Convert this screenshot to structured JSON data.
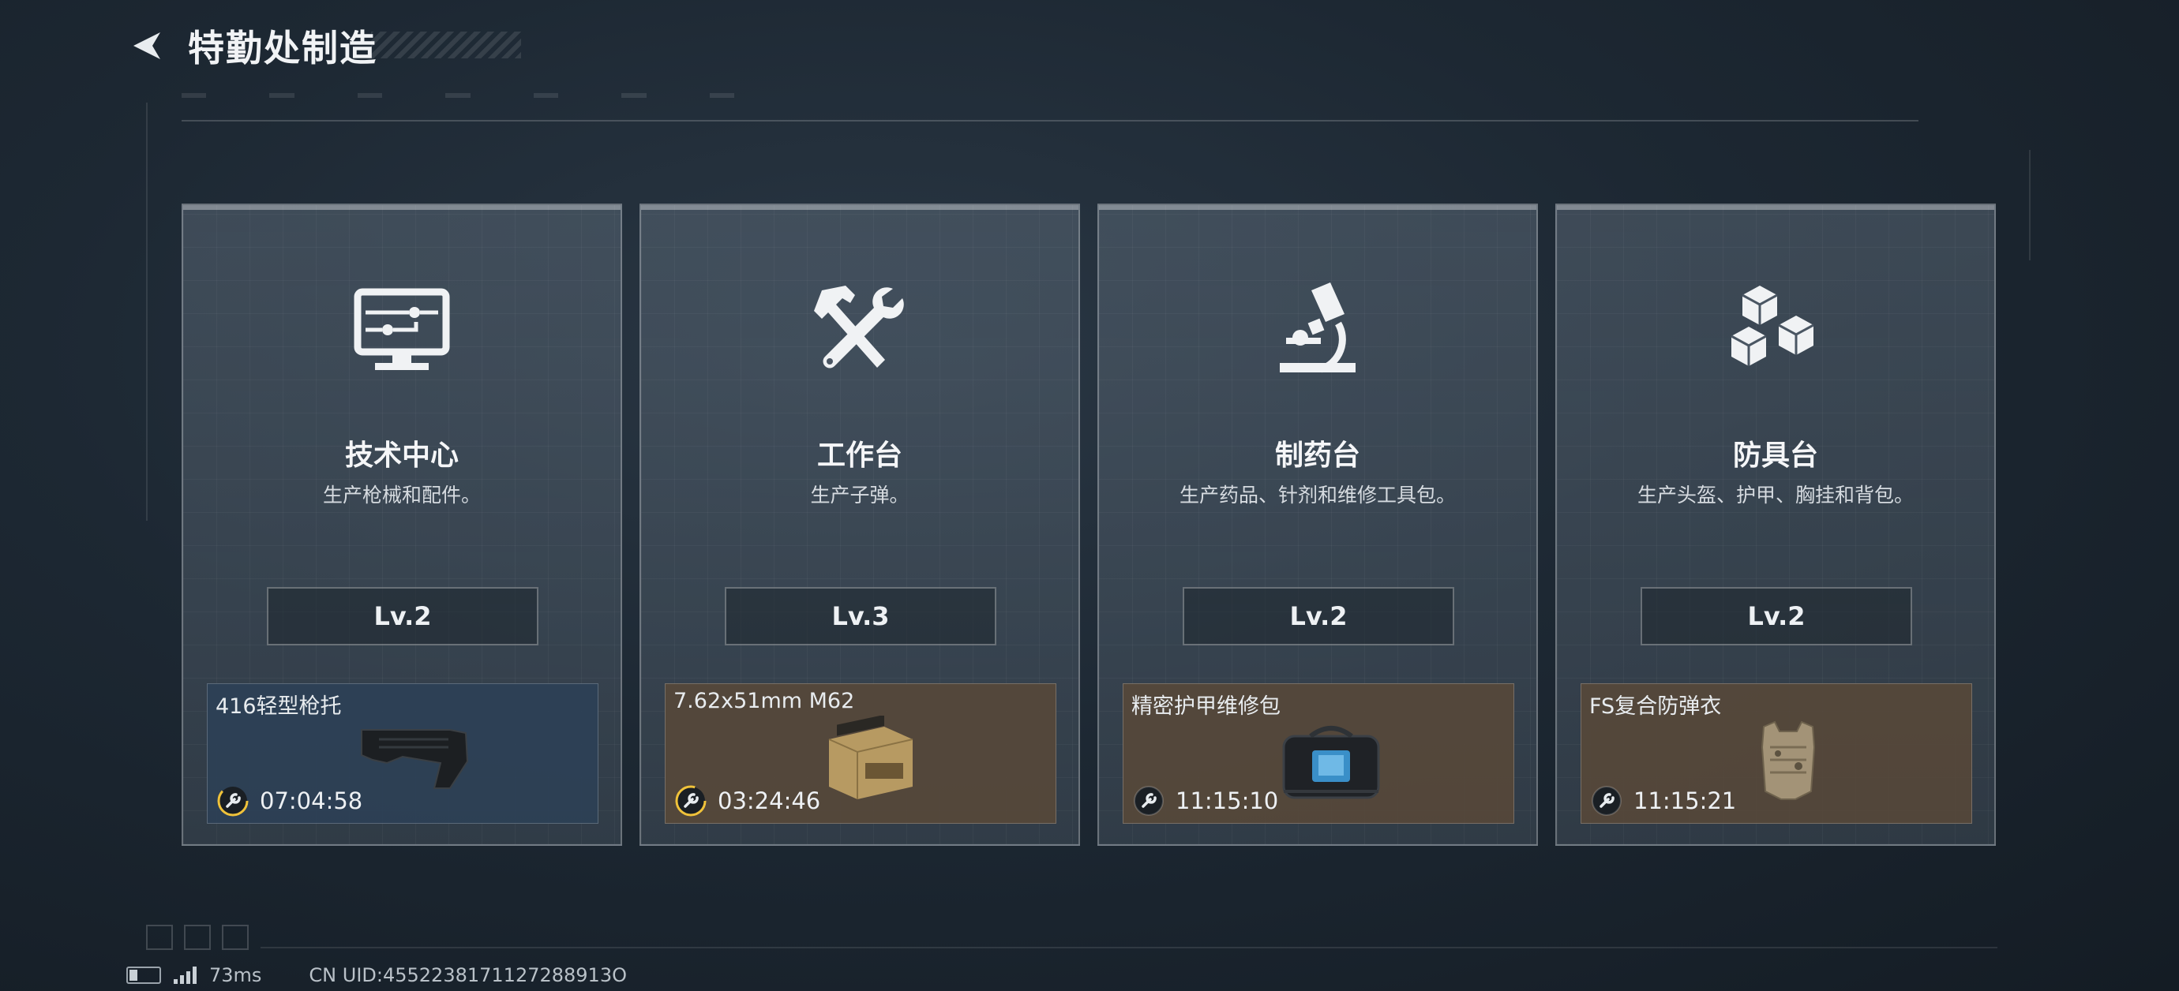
{
  "header": {
    "title": "特勤处制造"
  },
  "cards": [
    {
      "name": "技术中心",
      "desc": "生产枪械和配件。",
      "level": "Lv.2",
      "icon": "monitor-icon",
      "product": {
        "name": "416轻型枪托",
        "timer": "07:04:58",
        "style": "blue",
        "image": "rifle-stock"
      }
    },
    {
      "name": "工作台",
      "desc": "生产子弹。",
      "level": "Lv.3",
      "icon": "hammer-wrench-icon",
      "product": {
        "name": "7.62x51mm M62",
        "timer": "03:24:46",
        "style": "brown",
        "image": "ammo-box"
      }
    },
    {
      "name": "制药台",
      "desc": "生产药品、针剂和维修工具包。",
      "level": "Lv.2",
      "icon": "microscope-icon",
      "product": {
        "name": "精密护甲维修包",
        "timer": "11:15:10",
        "style": "brown",
        "image": "repair-kit-bag"
      }
    },
    {
      "name": "防具台",
      "desc": "生产头盔、护甲、胸挂和背包。",
      "level": "Lv.2",
      "icon": "boxes-icon",
      "product": {
        "name": "FS复合防弹衣",
        "timer": "11:15:21",
        "style": "brown",
        "image": "body-armor"
      }
    }
  ],
  "status": {
    "ping": "73ms",
    "uid": "CN UID:4552238171127288913O"
  },
  "colors": {
    "accent_timer": "#f0c23a",
    "product_blue": "#2c4056",
    "product_brown": "#56483a"
  }
}
